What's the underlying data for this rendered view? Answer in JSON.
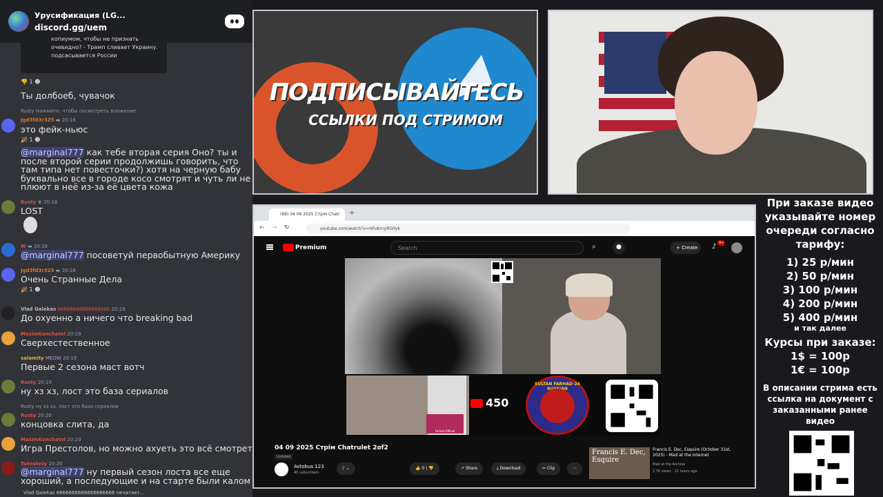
{
  "chat": {
    "server_name": "Урусификация (LG...",
    "invite": "discord.gg/uem",
    "quote_lines": [
      "копиумом, чтобы не признать",
      "очевидно? - Трамп сливает Украину.",
      "подсасывается России"
    ],
    "messages": [
      {
        "react": "👎 1  ☻",
        "text": "Ты долбоеб, чувачок"
      },
      {
        "reply": "Rusty  Нажмите, чтобы посмотреть вложение",
        "name": "Jgd3fd3r325",
        "time": "20:16",
        "text": "это фейк-ньюс",
        "react": "🎉 1  ☻"
      },
      {
        "mention": "@marginal777",
        "text": " как тебе вторая серия Оно? ты и после второй серии продолжишь говорить, что там типа нет повесточки?) хотя на черную бабу буквально все в городе косо смотрят и чуть ли не плюют в неё из-за её цвета кожа"
      },
      {
        "name": "Rusty",
        "time": "20:18",
        "text": "LOST"
      },
      {
        "name": "W",
        "time": "20:18",
        "mention": "@marginal777",
        "text": " посоветуй первобытную Америку"
      },
      {
        "name": "Jgd3fd3r325",
        "time": "20:18",
        "text": "Очень Странные Дела",
        "react": "🎉 1  ☻"
      },
      {
        "name": "Vlad Galekas",
        "extra": "66666666666666666",
        "time": "20:19",
        "text": "До охуенно а ничего что breaking bad"
      },
      {
        "name": "MasimKonchatel",
        "time": "20:19",
        "text": "Сверхестественное"
      },
      {
        "name": "salamity",
        "extra": "MEOW",
        "time": "20:19",
        "text": "Первые 2 сезона маст вотч"
      },
      {
        "name": "Rusty",
        "time": "20:19",
        "text": "ну хз хз, лост это база сериалов"
      },
      {
        "reply": "Rusty  ну хз хз, лост это база сериалов",
        "name": "Rusty",
        "time": "20:20",
        "text": "концовка слита, да"
      },
      {
        "name": "MasimKonchatel",
        "time": "20:20",
        "text": "Игра Престолов, но можно ахуеть это всё смотреть"
      },
      {
        "name": "Tuteshniy",
        "time": "20:20",
        "mention": "@marginal777",
        "text": " ну первый сезон лоста все еще хороший, а последующие и на старте были калом"
      }
    ],
    "typing": "Vlad Galekas 6666666666666666666 печатает..."
  },
  "promo": {
    "line1": "ПОДПИСЫВАЙТЕСЬ",
    "line2": "ССЫЛКИ ПОД СТРИМОМ"
  },
  "browser": {
    "tab_title": "(69) 04 09 2025 Стрім Chatr",
    "url": "youtube.com/watch?v=HFoKrnyRG0yk",
    "yt_brand": "Premium",
    "search_placeholder": "Search",
    "create_label": "Create",
    "notif_badge": "9+",
    "live_count": "450",
    "seal_text": "SULTAN FARHAD-24 RUSSIAN",
    "cam_label": "Farhad Official",
    "video_title": "04 09 2025 Стрім Chatrulet 2of2",
    "unlisted": "Unlisted",
    "channel_name": "Avtobus 123",
    "channel_subs": "40 subscribers",
    "likes": "0",
    "share_label": "Share",
    "download_label": "Download",
    "clip_label": "Clip",
    "rec_thumb_text": "Francis E. Dec, Esquire",
    "rec_title": "Francis E. Dec, Esquire (October 31st, 2025) - Mad at the Internet",
    "rec_channel": "Mad at the Archive",
    "rec_views": "2.7K views · 21 hours ago"
  },
  "info": {
    "header": "При заказе видео указывайте номер очереди согласно тарифу:",
    "tariffs": [
      "1) 25 р/мин",
      "2) 50 р/мин",
      "3) 100 р/мин",
      "4) 200 р/мин",
      "5) 400 р/мин"
    ],
    "etc": "и так далее",
    "rates_header": "Курсы при заказе:",
    "rates": [
      "1$ = 100р",
      "1€ = 100р"
    ],
    "note": "В описании стрима есть ссылка на документ с заказанными ранее видео"
  },
  "colors": {
    "discord_bg": "#313338",
    "mention_bg": "#3c4270",
    "yt_red": "#ff0000",
    "telegram_blue": "#1f88cf",
    "promo_orange": "#d9542b"
  }
}
